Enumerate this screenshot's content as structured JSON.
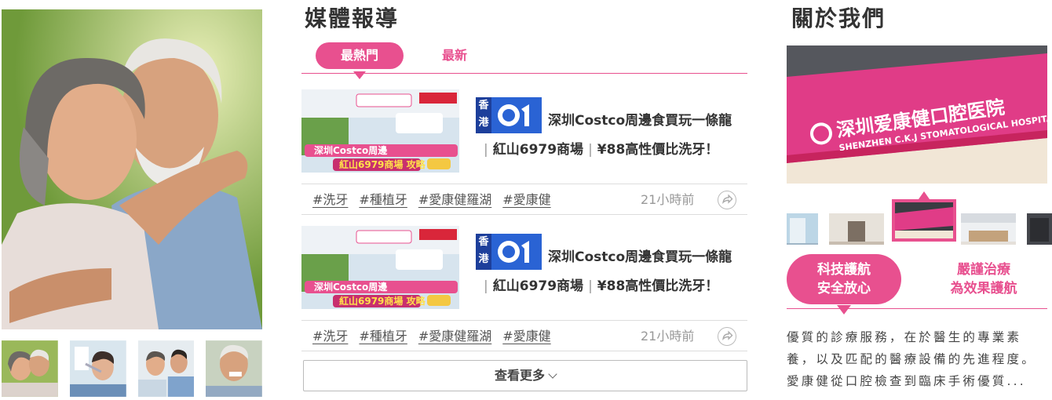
{
  "media": {
    "title": "媒體報導",
    "tabs": {
      "hot": "最熱門",
      "latest": "最新"
    },
    "articles": [
      {
        "source_hk": "香港",
        "title": "深圳Costco周邊食買玩一條龍",
        "subtitle_a": "紅山6979商場",
        "subtitle_b": "¥88高性價比洗牙！",
        "tags": [
          "#洗牙",
          "#種植牙",
          "#愛康健羅湖",
          "#愛康健"
        ],
        "time": "21小時前",
        "banner_line1": "深圳Costco周邊",
        "banner_line2": "紅山6979商場 攻略"
      },
      {
        "source_hk": "香港",
        "title": "深圳Costco周邊食買玩一條龍",
        "subtitle_a": "紅山6979商場",
        "subtitle_b": "¥88高性價比洗牙！",
        "tags": [
          "#洗牙",
          "#種植牙",
          "#愛康健羅湖",
          "#愛康健"
        ],
        "time": "21小時前",
        "banner_line1": "深圳Costco周邊",
        "banner_line2": "紅山6979商場 攻略"
      }
    ],
    "more_label": "查看更多"
  },
  "about": {
    "title": "關於我們",
    "hospital_sign": "深圳爱康健口腔医院",
    "hospital_sign_en": "SHENZHEN C.K.J STOMATOLOGICAL HOSPITAL",
    "pills": [
      {
        "line1": "科技護航",
        "line2": "安全放心"
      },
      {
        "line1": "嚴謹治療",
        "line2": "為效果護航"
      }
    ],
    "description": "優質的診療服務，在於醫生的專業素養，以及匹配的醫療設備的先進程度。愛康健從口腔檢查到臨床手術優質..."
  },
  "colors": {
    "accent": "#e8508f",
    "highlight": "#f6c9dc",
    "hk_blue": "#1d3f9b",
    "logo_blue": "#2a63d4"
  },
  "icons": {
    "share": "share-icon",
    "more": "chevron-down-icon"
  }
}
